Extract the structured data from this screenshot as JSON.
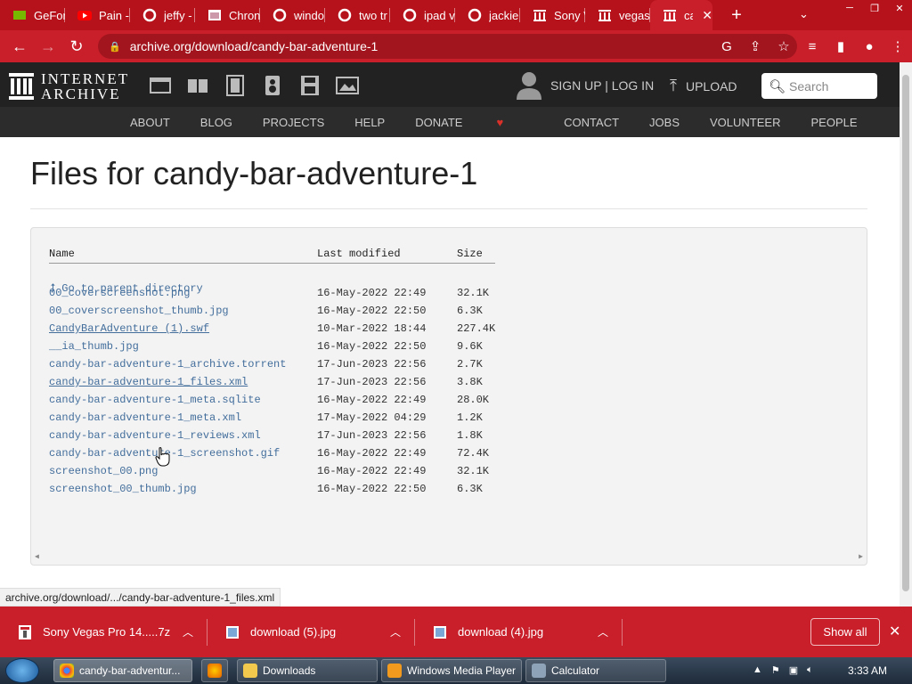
{
  "browser": {
    "tabs": [
      {
        "label": "GeFor",
        "icon": "nvidia-icon",
        "color": "#76b900"
      },
      {
        "label": "Pain -",
        "icon": "youtube-icon",
        "color": "#ff0000"
      },
      {
        "label": "jeffy -",
        "icon": "google-icon",
        "color": "#ffffff"
      },
      {
        "label": "Chron",
        "icon": "photo-icon",
        "color": "#ffffff"
      },
      {
        "label": "windo",
        "icon": "google-icon",
        "color": "#ffffff"
      },
      {
        "label": "two tr",
        "icon": "google-icon",
        "color": "#ffffff"
      },
      {
        "label": "ipad v",
        "icon": "google-icon",
        "color": "#ffffff"
      },
      {
        "label": "jackie",
        "icon": "google-icon",
        "color": "#ffffff"
      },
      {
        "label": "Sony V",
        "icon": "archive-icon",
        "color": "#ffffff"
      },
      {
        "label": "vegas",
        "icon": "archive-icon",
        "color": "#ffffff"
      },
      {
        "label": "ca",
        "icon": "archive-icon",
        "color": "#ffffff"
      }
    ],
    "url": "archive.org/download/candy-bar-adventure-1",
    "status_url": "archive.org/download/.../candy-bar-adventure-1_files.xml"
  },
  "ia": {
    "logo_line1": "INTERNET",
    "logo_line2": "ARCHIVE",
    "signin": "SIGN UP | LOG IN",
    "upload": "UPLOAD",
    "search_placeholder": "Search",
    "nav": [
      "ABOUT",
      "BLOG",
      "PROJECTS",
      "HELP",
      "DONATE",
      "CONTACT",
      "JOBS",
      "VOLUNTEER",
      "PEOPLE"
    ]
  },
  "page": {
    "title": "Files for candy-bar-adventure-1",
    "headers": {
      "name": "Name",
      "modified": "Last modified",
      "size": "Size"
    },
    "parent": "Go to parent directory",
    "files": [
      {
        "name": "00_coverscreenshot.png",
        "date": "16-May-2022 22:49",
        "size": "32.1K"
      },
      {
        "name": "00_coverscreenshot_thumb.jpg",
        "date": "16-May-2022 22:50",
        "size": "6.3K"
      },
      {
        "name": "CandyBarAdventure (1).swf",
        "date": "10-Mar-2022 18:44",
        "size": "227.4K"
      },
      {
        "name": "__ia_thumb.jpg",
        "date": "16-May-2022 22:50",
        "size": "9.6K"
      },
      {
        "name": "candy-bar-adventure-1_archive.torrent",
        "date": "17-Jun-2023 22:56",
        "size": "2.7K"
      },
      {
        "name": "candy-bar-adventure-1_files.xml",
        "date": "17-Jun-2023 22:56",
        "size": "3.8K"
      },
      {
        "name": "candy-bar-adventure-1_meta.sqlite",
        "date": "16-May-2022 22:49",
        "size": "28.0K"
      },
      {
        "name": "candy-bar-adventure-1_meta.xml",
        "date": "17-May-2022 04:29",
        "size": "1.2K"
      },
      {
        "name": "candy-bar-adventure-1_reviews.xml",
        "date": "17-Jun-2023 22:56",
        "size": "1.8K"
      },
      {
        "name": "candy-bar-adventure-1_screenshot.gif",
        "date": "16-May-2022 22:49",
        "size": "72.4K"
      },
      {
        "name": "screenshot_00.png",
        "date": "16-May-2022 22:49",
        "size": "32.1K"
      },
      {
        "name": "screenshot_00_thumb.jpg",
        "date": "16-May-2022 22:50",
        "size": "6.3K"
      }
    ]
  },
  "downloads": {
    "items": [
      "Sony Vegas Pro 14.....7z",
      "download (5).jpg",
      "download (4).jpg"
    ],
    "show_all": "Show all"
  },
  "taskbar": {
    "apps": [
      "candy-bar-adventur...",
      "Downloads",
      "Windows Media Player",
      "Calculator"
    ],
    "clock": "3:33 AM"
  },
  "colors": {
    "accent": "#c81f2a",
    "link": "#436e9c",
    "ia_header": "#222222"
  }
}
